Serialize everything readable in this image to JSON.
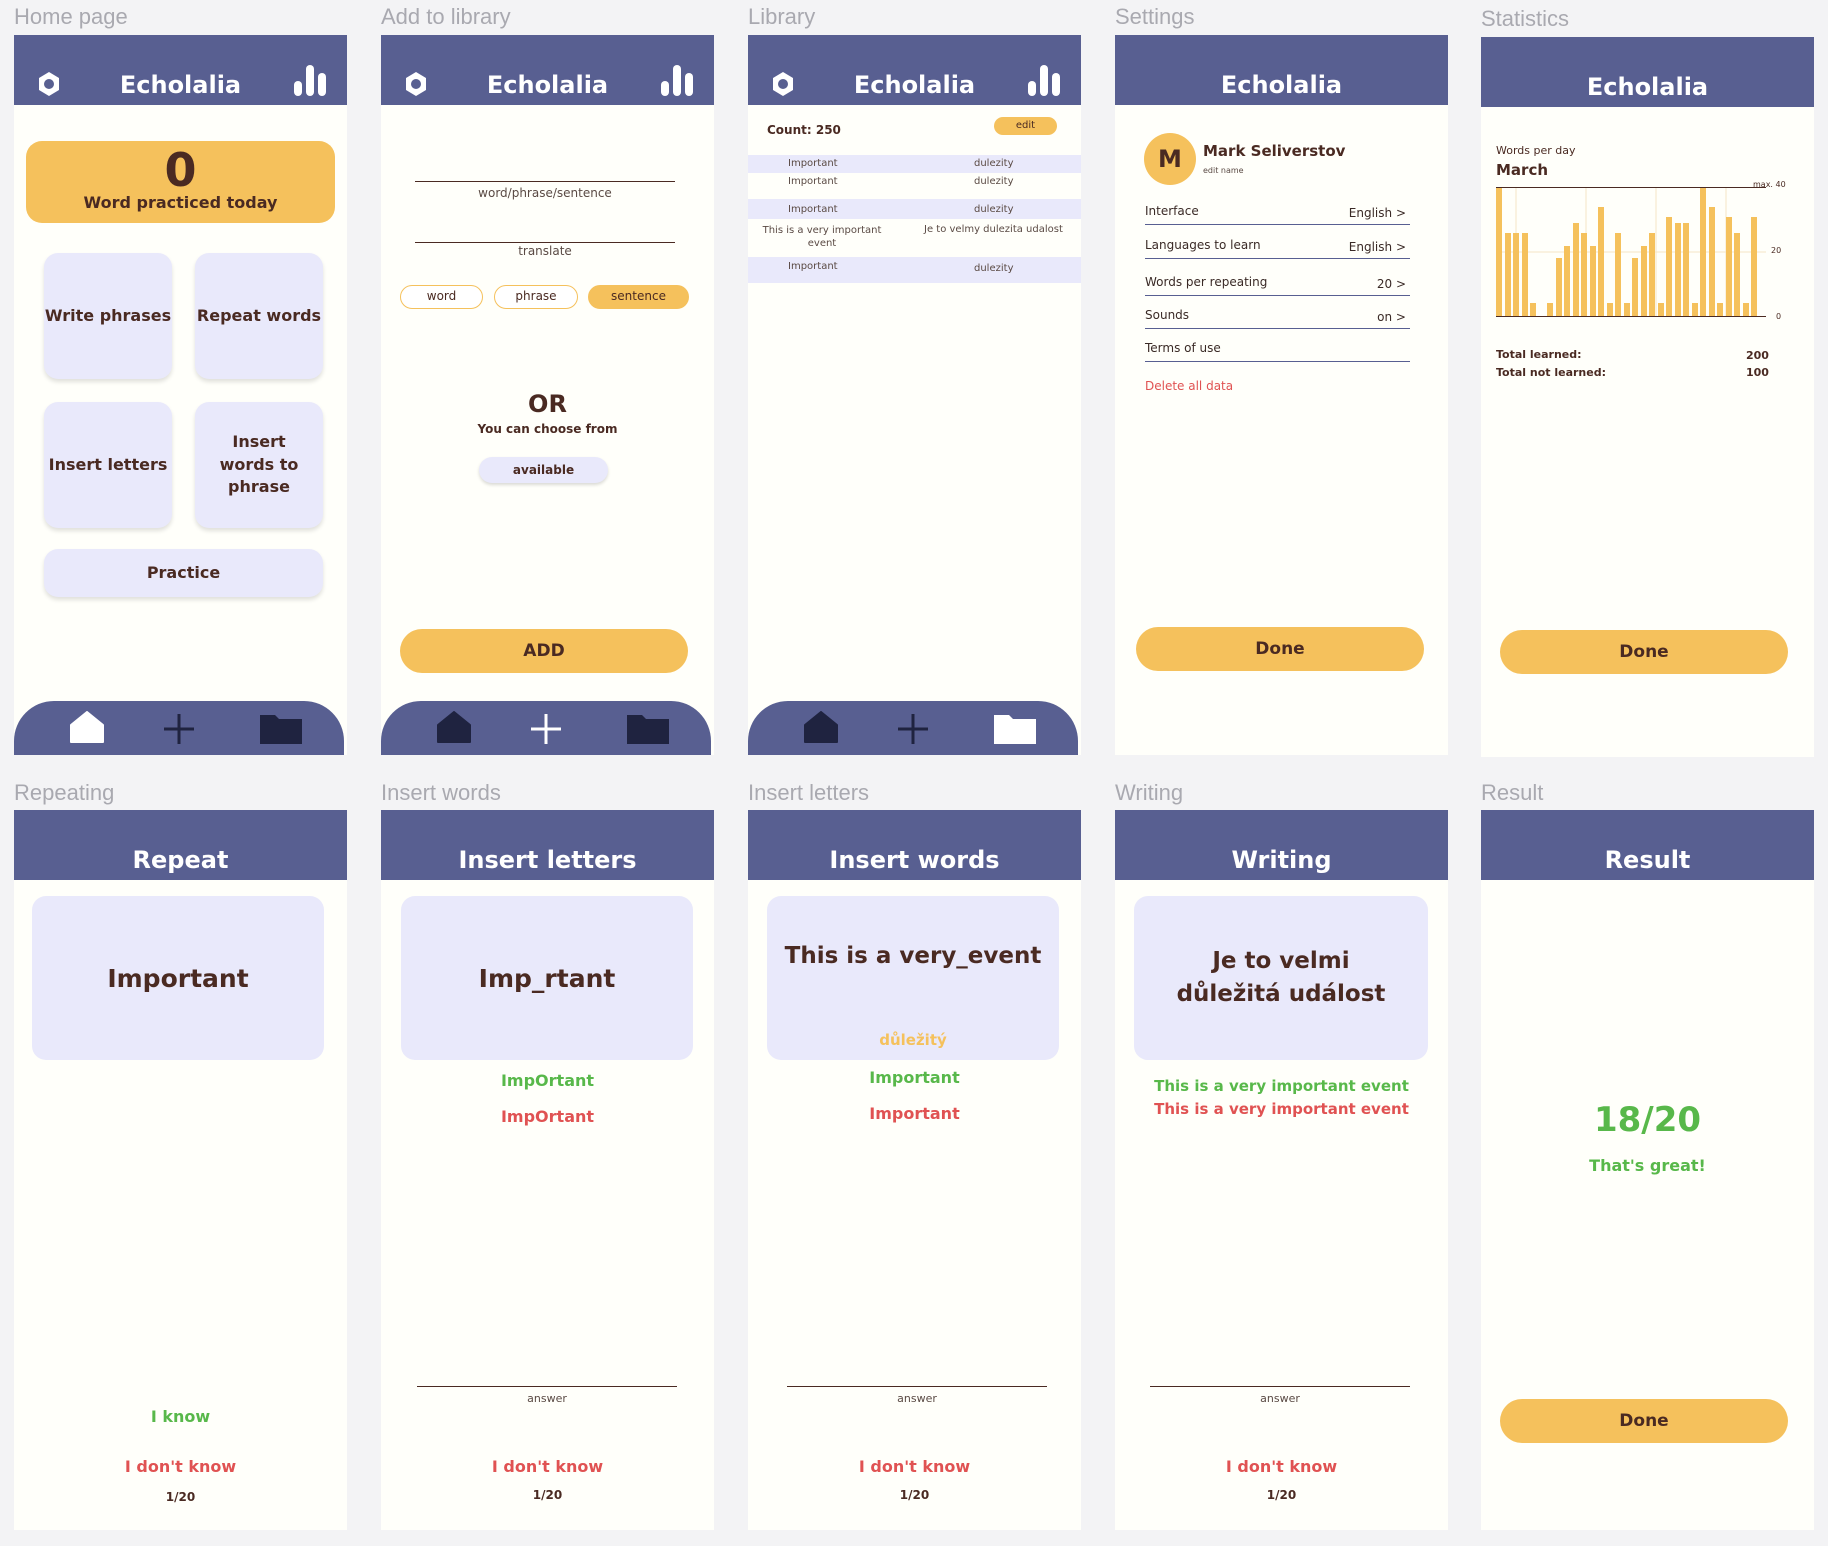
{
  "labels": {
    "home": "Home page",
    "add": "Add to library",
    "library": "Library",
    "settings": "Settings",
    "statistics": "Statistics",
    "repeating": "Repeating",
    "insert_words": "Insert words",
    "insert_letters": "Insert letters",
    "writing": "Writing",
    "result": "Result"
  },
  "app_title": "Echolalia",
  "home": {
    "count": "0",
    "count_label": "Word practiced today",
    "tiles": [
      "Write phrases",
      "Repeat words",
      "Insert letters",
      "Insert words to phrase",
      "Practice"
    ]
  },
  "add": {
    "word_placeholder": "word/phrase/sentence",
    "translate_placeholder": "translate",
    "pills": [
      "word",
      "phrase",
      "sentence"
    ],
    "or": "OR",
    "choose": "You can choose from",
    "available": "available",
    "add_button": "ADD"
  },
  "library": {
    "count": "Count: 250",
    "edit": "edit",
    "rows": [
      {
        "left": "Important",
        "right": "dulezity",
        "shade": true
      },
      {
        "left": "Important",
        "right": "dulezity",
        "shade": false
      },
      {
        "left": "Important",
        "right": "dulezity",
        "shade": true
      },
      {
        "left": "This is a very important event",
        "right": "Je to velmy dulezita udalost",
        "shade": false
      },
      {
        "left": "Important",
        "right": "dulezity",
        "shade": true
      }
    ]
  },
  "settings": {
    "avatar": "M",
    "name": "Mark Seliverstov",
    "edit_name": "edit name",
    "rows": [
      {
        "label": "Interface",
        "value": "English >"
      },
      {
        "label": "Languages to learn",
        "value": "English >"
      },
      {
        "label": "Words per repeating",
        "value": "20 >"
      },
      {
        "label": "Sounds",
        "value": "on >"
      },
      {
        "label": "Terms of use",
        "value": ""
      }
    ],
    "delete": "Delete all data",
    "done": "Done"
  },
  "statistics": {
    "title": "Words per day",
    "month": "March",
    "max_label": "max. 40",
    "mid_label": "20",
    "zero_label": "0",
    "total_learned_label": "Total learned:",
    "total_learned": "200",
    "total_not_learned_label": "Total not learned:",
    "total_not_learned": "100",
    "done": "Done"
  },
  "chart_data": {
    "type": "bar",
    "title": "Words per day",
    "xlabel": "March",
    "ylabel": "",
    "ylim": [
      0,
      40
    ],
    "values": [
      40,
      26,
      26,
      26,
      4,
      0,
      4,
      18,
      22,
      29,
      26,
      22,
      34,
      4,
      26,
      4,
      18,
      22,
      26,
      4,
      31,
      29,
      29,
      4,
      40,
      34,
      4,
      31,
      26,
      4,
      31
    ]
  },
  "repeat": {
    "title": "Repeat",
    "word": "Important",
    "know": "I know",
    "dont_know": "I don't know",
    "progress": "1/20"
  },
  "insert_letters_screen": {
    "title": "Insert letters",
    "word": "Imp_rtant",
    "correct": "ImpOrtant",
    "wrong": "ImpOrtant",
    "answer": "answer",
    "dont_know": "I don't know",
    "progress": "1/20"
  },
  "insert_words_screen": {
    "title": "Insert words",
    "phrase": "This is a very_event",
    "hint": "důležitý",
    "correct": "Important",
    "wrong": "Important",
    "answer": "answer",
    "dont_know": "I don't know",
    "progress": "1/20"
  },
  "writing_screen": {
    "title": "Writing",
    "phrase": "Je to velmi důležitá událost",
    "correct": "This is a very important event",
    "wrong": "This is a very important event",
    "answer": "answer",
    "dont_know": "I don't know",
    "progress": "1/20"
  },
  "result_screen": {
    "title": "Result",
    "score": "18/20",
    "message": "That's great!",
    "done": "Done"
  },
  "colors": {
    "header": "#585f91",
    "accent": "#f5c15c",
    "tile": "#e9e9fb",
    "text": "#4a2a22",
    "green": "#58b84a",
    "red": "#e05252"
  }
}
